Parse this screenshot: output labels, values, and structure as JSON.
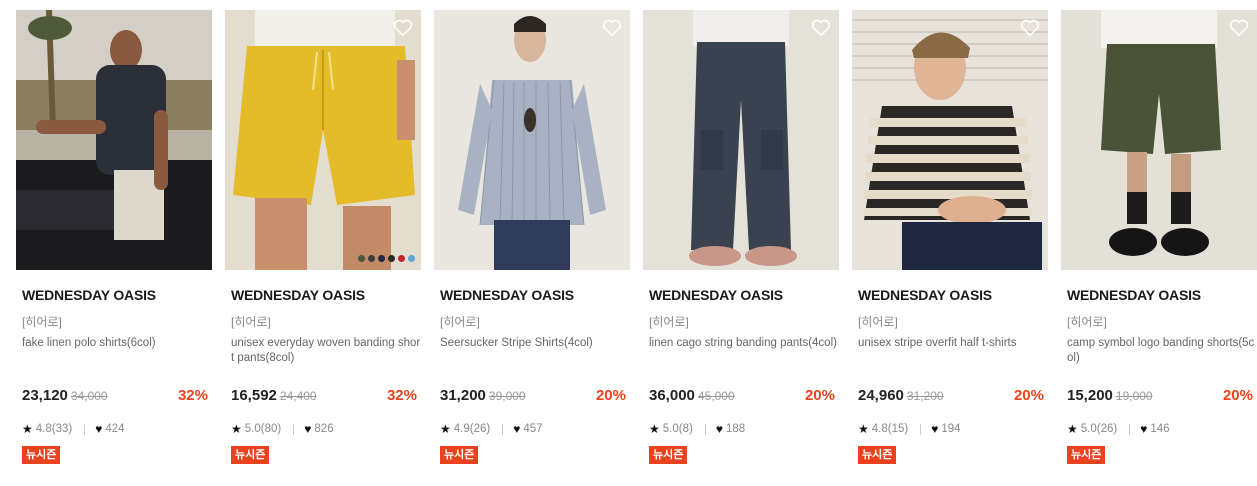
{
  "products": [
    {
      "brand": "WEDNESDAY OASIS",
      "seller": "[히어로]",
      "name": "fake linen polo shirts(6col)",
      "price": "23,120",
      "original_price": "34,000",
      "discount": "32%",
      "rating": "4.8(33)",
      "likes": "424",
      "badge": "뉴시즌",
      "swatches": []
    },
    {
      "brand": "WEDNESDAY OASIS",
      "seller": "[히어로]",
      "name": "unisex everyday woven banding short pants(8col)",
      "price": "16,592",
      "original_price": "24,400",
      "discount": "32%",
      "rating": "5.0(80)",
      "likes": "826",
      "badge": "뉴시즌",
      "swatches": [
        "#4a5a3a",
        "#3b3b3b",
        "#1f2a44",
        "#2a2a2a",
        "#c0242c",
        "#5aa6d6"
      ]
    },
    {
      "brand": "WEDNESDAY OASIS",
      "seller": "[히어로]",
      "name": "Seersucker Stripe Shirts(4col)",
      "price": "31,200",
      "original_price": "39,000",
      "discount": "20%",
      "rating": "4.9(26)",
      "likes": "457",
      "badge": "뉴시즌",
      "swatches": []
    },
    {
      "brand": "WEDNESDAY OASIS",
      "seller": "[히어로]",
      "name": "linen cago string banding pants(4col)",
      "price": "36,000",
      "original_price": "45,000",
      "discount": "20%",
      "rating": "5.0(8)",
      "likes": "188",
      "badge": "뉴시즌",
      "swatches": []
    },
    {
      "brand": "WEDNESDAY OASIS",
      "seller": "[히어로]",
      "name": "unisex stripe overfit half t-shirts",
      "price": "24,960",
      "original_price": "31,200",
      "discount": "20%",
      "rating": "4.8(15)",
      "likes": "194",
      "badge": "뉴시즌",
      "swatches": []
    },
    {
      "brand": "WEDNESDAY OASIS",
      "seller": "[히어로]",
      "name": "camp symbol logo banding shorts(5col)",
      "price": "15,200",
      "original_price": "19,000",
      "discount": "20%",
      "rating": "5.0(26)",
      "likes": "146",
      "badge": "뉴시즌",
      "swatches": []
    }
  ],
  "icons": {
    "like": "heart-outline-icon",
    "rating": "star-icon",
    "likes": "heart-filled-icon"
  },
  "colors": {
    "discount": "#e8421e",
    "badge_bg": "#e8421e"
  }
}
